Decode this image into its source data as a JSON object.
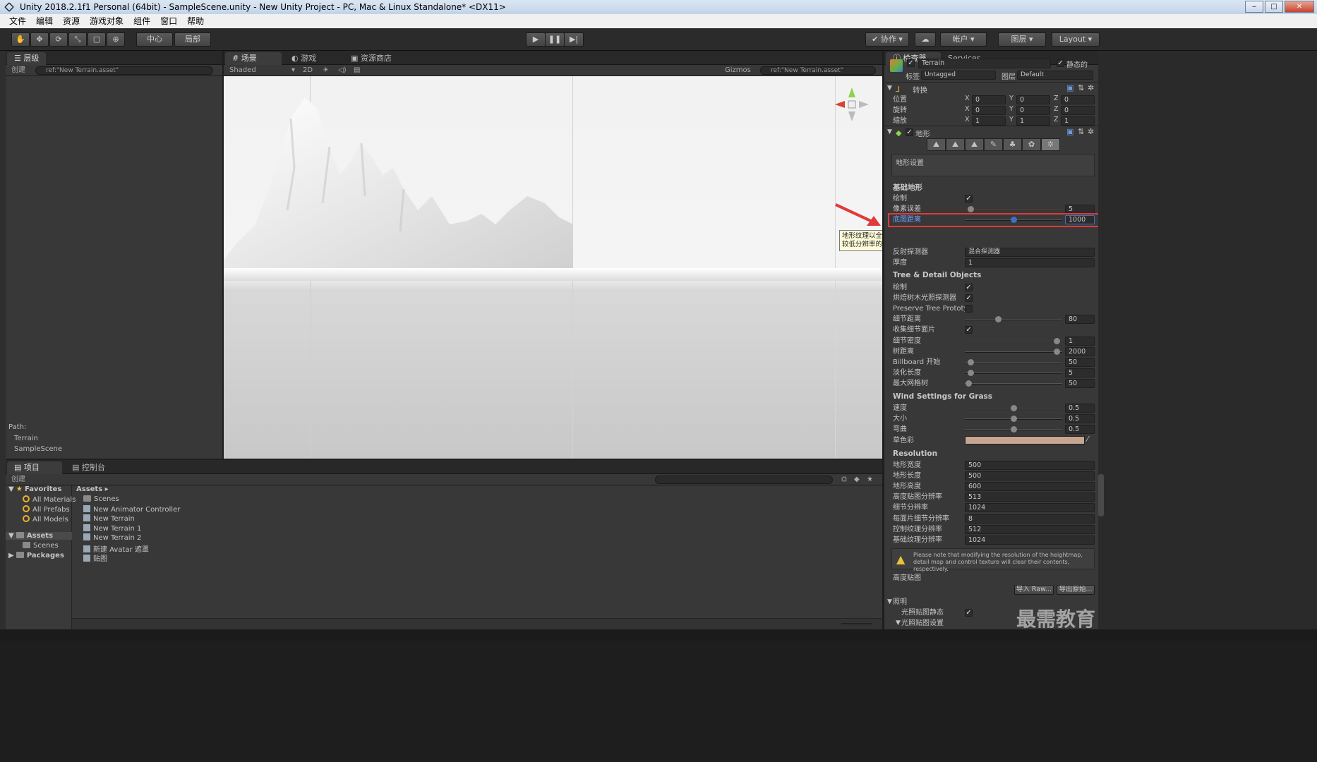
{
  "title": "Unity 2018.2.1f1 Personal (64bit) - SampleScene.unity - New Unity Project - PC, Mac & Linux Standalone* <DX11>",
  "menu": [
    "文件",
    "编辑",
    "资源",
    "游戏对象",
    "组件",
    "窗口",
    "帮助"
  ],
  "toolbar": {
    "pivot": "中心",
    "local": "局部",
    "collab": "协作",
    "account": "帐户",
    "layers": "图层",
    "layout": "Layout"
  },
  "hierarchy": {
    "tab": "层级",
    "create": "创建",
    "search": "ref:\"New Terrain.asset\"",
    "path_label": "Path:",
    "path_items": [
      "Terrain",
      "SampleScene"
    ]
  },
  "scene": {
    "tabs": [
      "场景",
      "游戏",
      "资源商店"
    ],
    "shading": "Shaded",
    "mode2d": "2D",
    "gizmos": "Gizmos",
    "search": "ref:\"New Terrain.asset\"",
    "tooltip": "地形纹理以全分辨率显示的最大距离。超过此距离将使用较低分辨率的合成图像来提高效率。"
  },
  "inspector": {
    "tabs": [
      "检查器",
      "Services"
    ],
    "object_name": "Terrain",
    "static_label": "静态的",
    "tag_label": "标签",
    "tag_value": "Untagged",
    "layer_label": "图层",
    "layer_value": "Default",
    "transform_title": "转换",
    "transform_rows": [
      {
        "label": "位置",
        "x": "0",
        "y": "0",
        "z": "0"
      },
      {
        "label": "旋转",
        "x": "0",
        "y": "0",
        "z": "0"
      },
      {
        "label": "缩放",
        "x": "1",
        "y": "1",
        "z": "1"
      }
    ],
    "terrain_title": "地形",
    "settings_title": "地形设置",
    "basic_title": "基础地形",
    "basic_rows": [
      {
        "label": "绘制",
        "type": "check"
      },
      {
        "label": "像素误差",
        "type": "slider",
        "value": "5",
        "pos": 0.03
      },
      {
        "label": "底图距离",
        "type": "slider",
        "value": "1000",
        "pos": 0.5,
        "highlight": true
      }
    ],
    "reflection_label": "反射探测器",
    "reflection_value": "混合探测器",
    "thickness_label": "厚度",
    "thickness_value": "1",
    "tree_title": "Tree & Detail Objects",
    "tree_rows": [
      {
        "label": "绘制",
        "type": "check",
        "checked": true
      },
      {
        "label": "烘焙树木光照探测器",
        "type": "check",
        "checked": true
      },
      {
        "label": "Preserve Tree Prototyp",
        "type": "check",
        "checked": false
      },
      {
        "label": "细节距离",
        "type": "slider",
        "value": "80",
        "pos": 0.33
      },
      {
        "label": "收集细节面片",
        "type": "check",
        "checked": true
      },
      {
        "label": "细节密度",
        "type": "slider",
        "value": "1",
        "pos": 0.98
      },
      {
        "label": "树距离",
        "type": "slider",
        "value": "2000",
        "pos": 0.98
      },
      {
        "label": "Billboard 开始",
        "type": "slider",
        "value": "50",
        "pos": 0.03
      },
      {
        "label": "淡化长度",
        "type": "slider",
        "value": "5",
        "pos": 0.03
      },
      {
        "label": "最大网格树",
        "type": "slider",
        "value": "50",
        "pos": 0.01
      }
    ],
    "wind_title": "Wind Settings for Grass",
    "wind_rows": [
      {
        "label": "速度",
        "value": "0.5",
        "pos": 0.5
      },
      {
        "label": "大小",
        "value": "0.5",
        "pos": 0.5
      },
      {
        "label": "弯曲",
        "value": "0.5",
        "pos": 0.5
      }
    ],
    "grass_tint_label": "草色彩",
    "grass_tint_color": "#c7a591",
    "res_title": "Resolution",
    "res_rows": [
      {
        "label": "地形宽度",
        "value": "500"
      },
      {
        "label": "地形长度",
        "value": "500"
      },
      {
        "label": "地形高度",
        "value": "600"
      },
      {
        "label": "高度贴图分辨率",
        "value": "513"
      },
      {
        "label": "细节分辨率",
        "value": "1024"
      },
      {
        "label": "每面片细节分辨率",
        "value": "8"
      },
      {
        "label": "控制纹理分辨率",
        "value": "512"
      },
      {
        "label": "基础纹理分辨率",
        "value": "1024"
      }
    ],
    "warning": "Please note that modifying the resolution of the heightmap, detail map and control texture will clear their contents, respectively.",
    "heightmap_title": "高度贴图",
    "import_btn": "导入 Raw...",
    "export_btn": "导出原始...",
    "lighting_title": "照明",
    "lightmap_static_label": "光照贴图静态",
    "lightmap_settings_label": "光照贴图设置"
  },
  "project": {
    "tabs": [
      "项目",
      "控制台"
    ],
    "create": "创建",
    "favorites_label": "Favorites",
    "favorites": [
      "All Materials",
      "All Prefabs",
      "All Models"
    ],
    "assets_label": "Assets",
    "assets_sub": [
      "Scenes"
    ],
    "packages_label": "Packages",
    "breadcrumb": "Assets",
    "files": [
      "Scenes",
      "New Animator Controller",
      "New Terrain",
      "New Terrain 1",
      "New Terrain 2",
      "新建 Avatar 遮罩",
      "贴图"
    ]
  },
  "watermark": "最需教育",
  "colors": {
    "highlight_red": "#e03a3a",
    "accent_blue": "#3d6fc6"
  }
}
